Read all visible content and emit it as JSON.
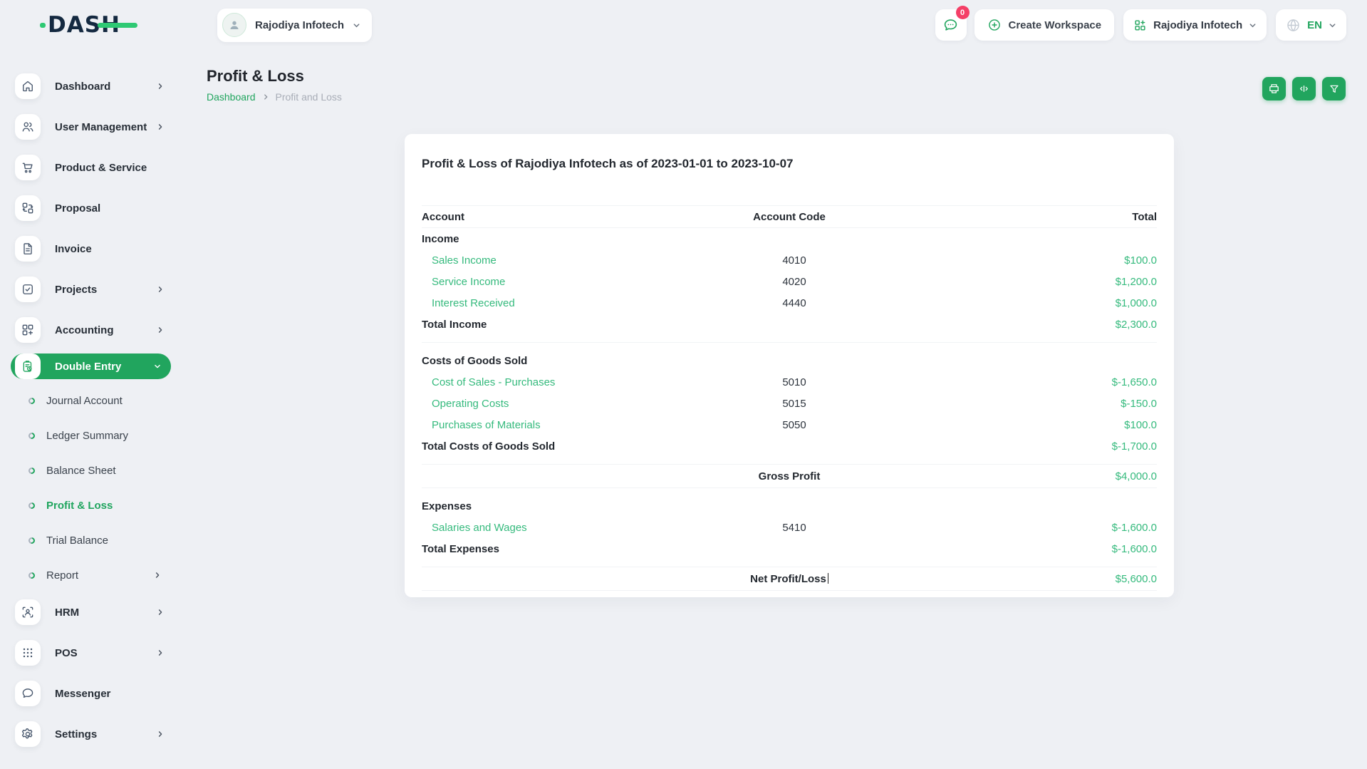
{
  "brand": {
    "name": "DASH"
  },
  "colors": {
    "primary": "#21a55e",
    "value_green": "#35ba7d",
    "logo_green": "#2ec973",
    "badge_pink": "#f43f67",
    "navy": "#142940"
  },
  "topbar": {
    "workspace_selector": "Rajodiya Infotech",
    "chat_badge": "0",
    "create_workspace": "Create Workspace",
    "account_selector": "Rajodiya Infotech",
    "language": "EN"
  },
  "page": {
    "title": "Profit & Loss",
    "breadcrumb_home": "Dashboard",
    "breadcrumb_current": "Profit and Loss"
  },
  "sidebar": {
    "groups": [
      {
        "type": "main",
        "items": [
          {
            "label": "Dashboard",
            "icon": "home-icon",
            "chevron": true
          },
          {
            "label": "User Management",
            "icon": "users-icon",
            "chevron": true
          },
          {
            "label": "Product & Service",
            "icon": "cart-icon",
            "chevron": false
          },
          {
            "label": "Proposal",
            "icon": "swap-boxes-icon",
            "chevron": false
          },
          {
            "label": "Invoice",
            "icon": "invoice-icon",
            "chevron": false
          },
          {
            "label": "Projects",
            "icon": "check-square-icon",
            "chevron": true
          },
          {
            "label": "Accounting",
            "icon": "grid-plus-icon",
            "chevron": true
          },
          {
            "label": "Double Entry",
            "icon": "clipboard-clock-icon",
            "chevron": true,
            "active": true
          }
        ]
      },
      {
        "type": "sub",
        "items": [
          {
            "label": "Journal Account"
          },
          {
            "label": "Ledger Summary"
          },
          {
            "label": "Balance Sheet"
          },
          {
            "label": "Profit & Loss",
            "active": true
          },
          {
            "label": "Trial Balance"
          },
          {
            "label": "Report",
            "chevron": true
          }
        ]
      },
      {
        "type": "main",
        "items": [
          {
            "label": "HRM",
            "icon": "person-scan-icon",
            "chevron": true
          },
          {
            "label": "POS",
            "icon": "dots-grid-icon",
            "chevron": true
          },
          {
            "label": "Messenger",
            "icon": "chat-icon",
            "chevron": false
          },
          {
            "label": "Settings",
            "icon": "gear-icon",
            "chevron": true
          }
        ]
      }
    ]
  },
  "report": {
    "title": "Profit & Loss of Rajodiya Infotech as of 2023-01-01 to 2023-10-07",
    "columns": {
      "account": "Account",
      "code": "Account Code",
      "total": "Total"
    },
    "rows": [
      {
        "type": "section",
        "account": "Income"
      },
      {
        "type": "item",
        "account": "Sales Income",
        "code": "4010",
        "total": "$100.0"
      },
      {
        "type": "item",
        "account": "Service Income",
        "code": "4020",
        "total": "$1,200.0"
      },
      {
        "type": "item",
        "account": "Interest Received",
        "code": "4440",
        "total": "$1,000.0"
      },
      {
        "type": "total",
        "account": "Total Income",
        "total": "$2,300.0"
      },
      {
        "type": "gap"
      },
      {
        "type": "section",
        "account": "Costs of Goods Sold"
      },
      {
        "type": "item",
        "account": "Cost of Sales - Purchases",
        "code": "5010",
        "total": "$-1,650.0"
      },
      {
        "type": "item",
        "account": "Operating Costs",
        "code": "5015",
        "total": "$-150.0"
      },
      {
        "type": "item",
        "account": "Purchases of Materials",
        "code": "5050",
        "total": "$100.0"
      },
      {
        "type": "total",
        "account": "Total Costs of Goods Sold",
        "total": "$-1,700.0"
      },
      {
        "type": "summary",
        "label": "Gross Profit",
        "total": "$4,000.0"
      },
      {
        "type": "section",
        "account": "Expenses"
      },
      {
        "type": "item",
        "account": "Salaries and Wages",
        "code": "5410",
        "total": "$-1,600.0"
      },
      {
        "type": "total",
        "account": "Total Expenses",
        "total": "$-1,600.0"
      },
      {
        "type": "summary",
        "label": "Net Profit/Loss",
        "total": "$5,600.0",
        "caret": true
      }
    ]
  }
}
